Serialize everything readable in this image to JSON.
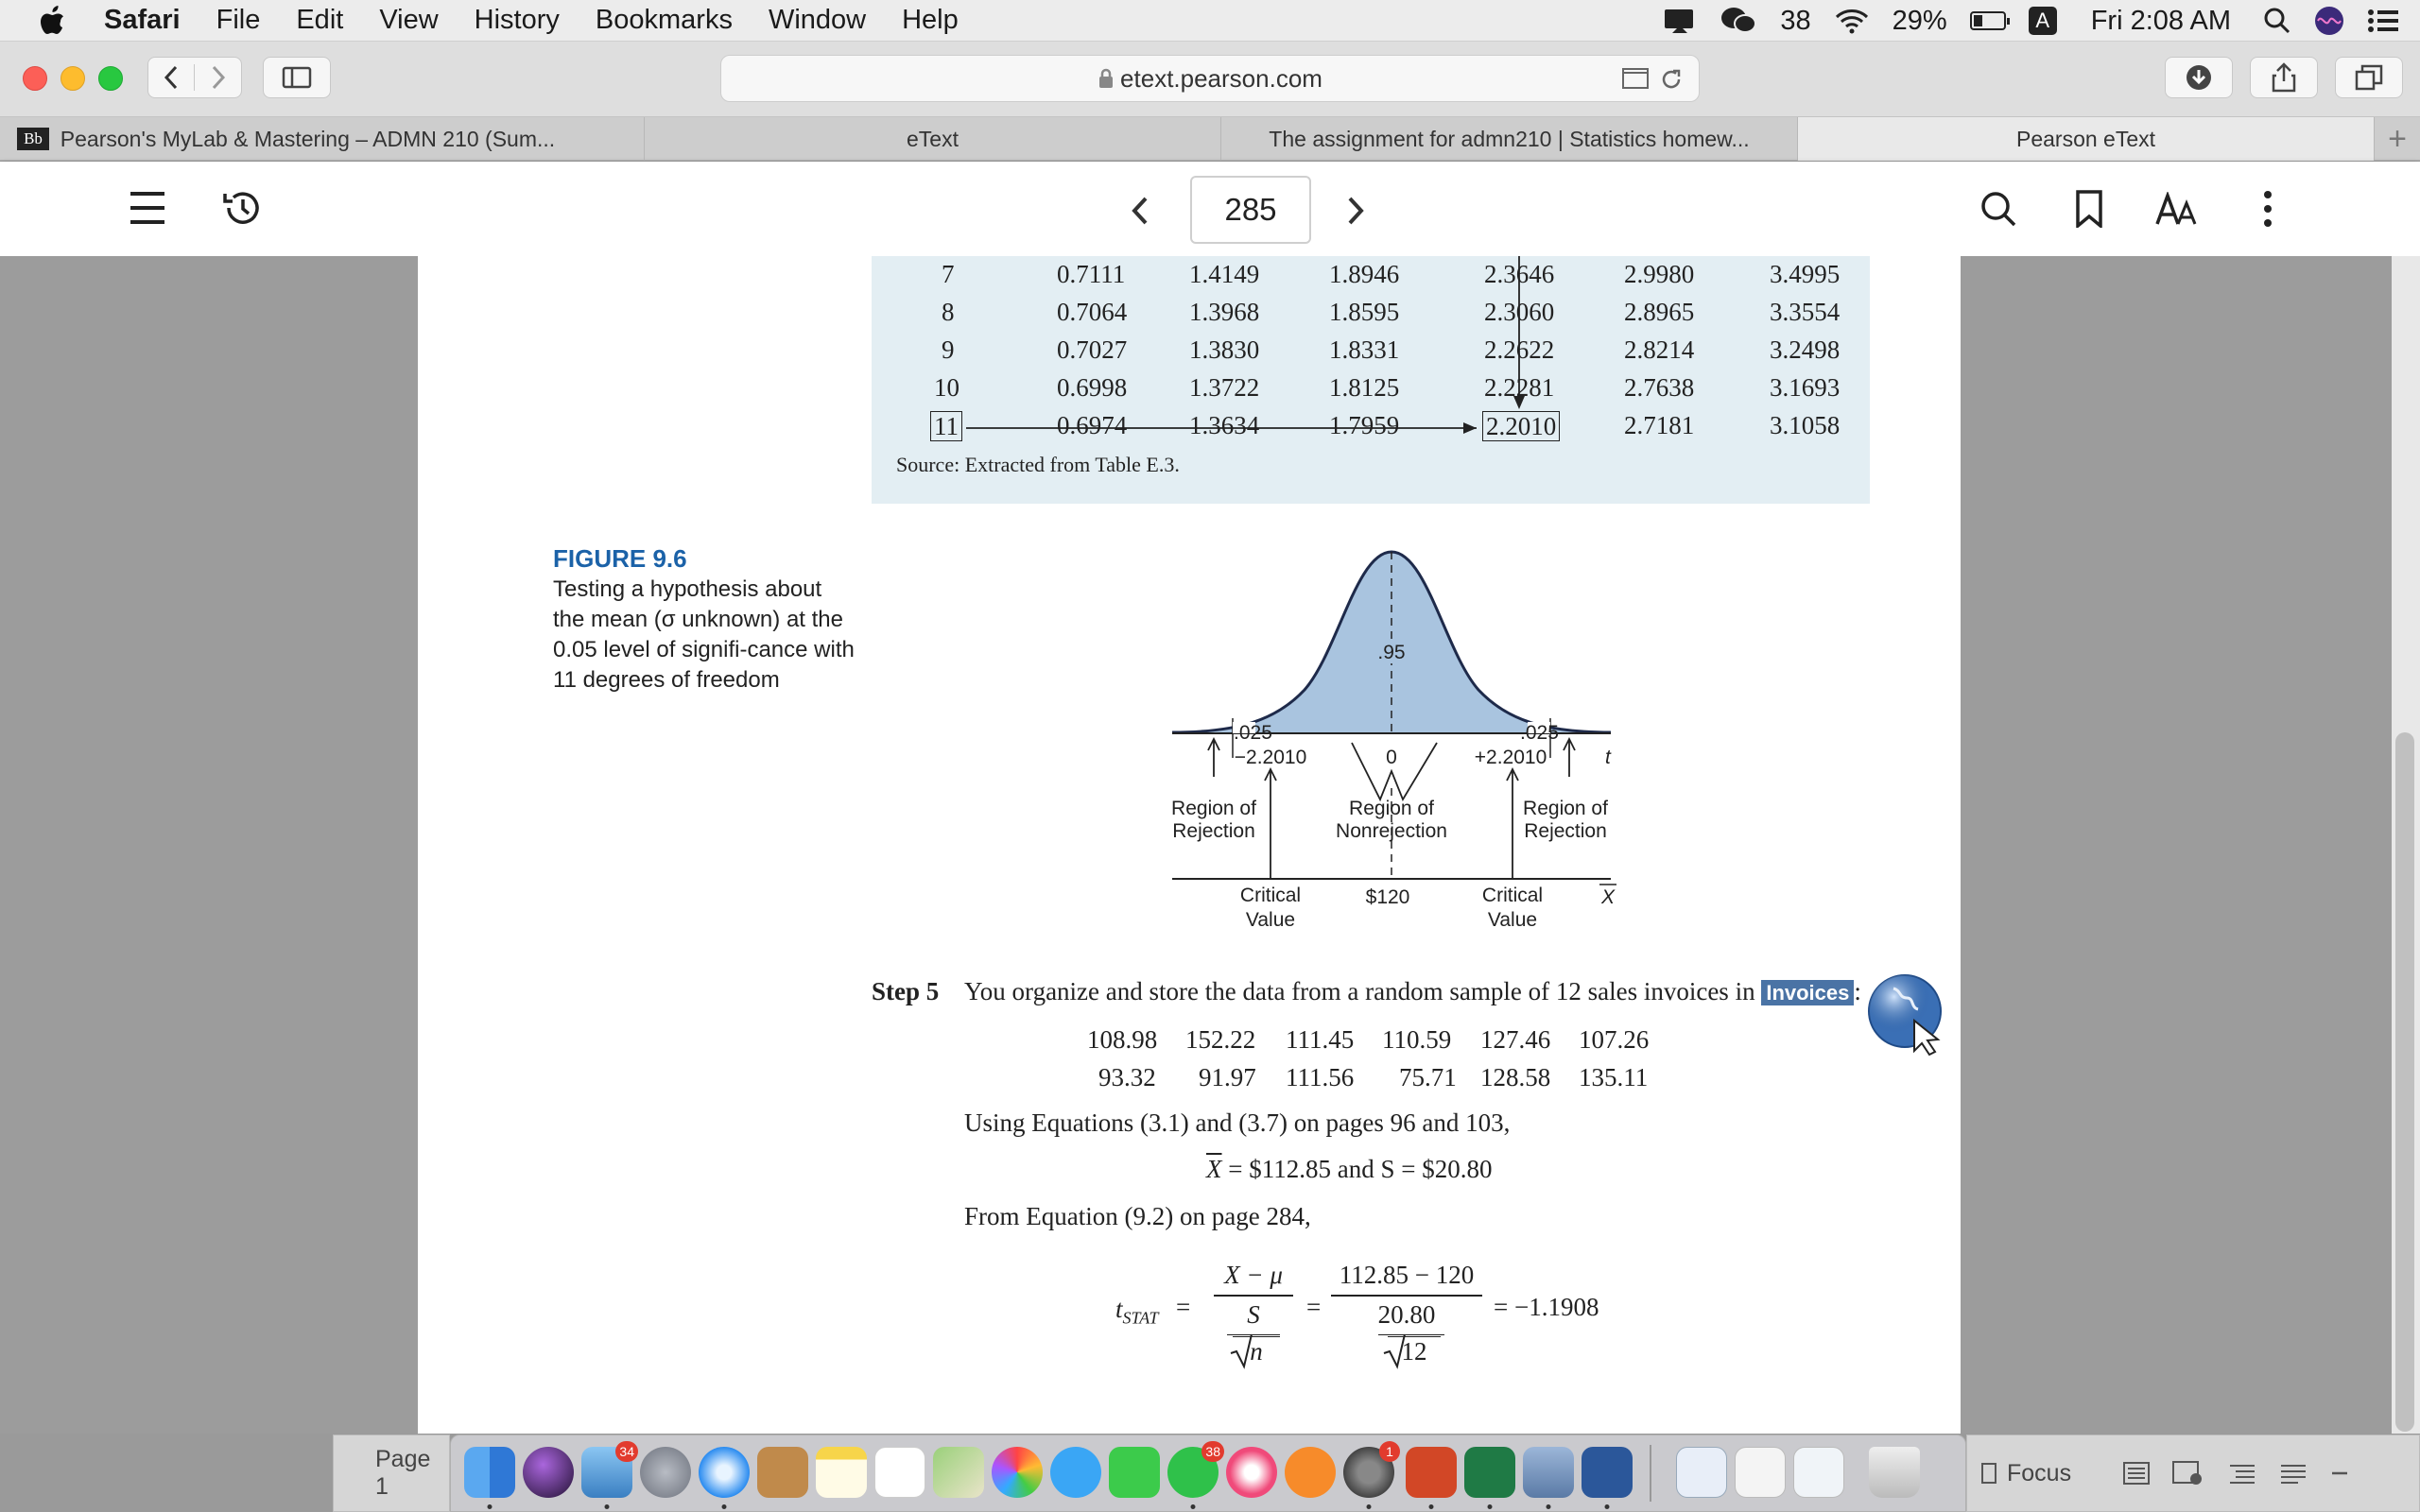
{
  "menubar": {
    "app": "Safari",
    "items": [
      "File",
      "Edit",
      "View",
      "History",
      "Bookmarks",
      "Window",
      "Help"
    ],
    "wechat_count": "38",
    "battery": "29%",
    "battery_level": 0.29,
    "input_source": "A",
    "clock": "Fri 2:08 AM"
  },
  "browser": {
    "url": "etext.pearson.com",
    "tabs": [
      {
        "label": "Pearson's MyLab & Mastering – ADMN 210 (Sum...",
        "badge": "Bb"
      },
      {
        "label": "eText"
      },
      {
        "label": "The assignment for admn210 | Statistics homew..."
      },
      {
        "label": "Pearson eText"
      }
    ],
    "new_tab": "+"
  },
  "reader": {
    "page_number": "285"
  },
  "table": {
    "rows": [
      [
        "7",
        "0.7111",
        "1.4149",
        "1.8946",
        "2.3646",
        "2.9980",
        "3.4995"
      ],
      [
        "8",
        "0.7064",
        "1.3968",
        "1.8595",
        "2.3060",
        "2.8965",
        "3.3554"
      ],
      [
        "9",
        "0.7027",
        "1.3830",
        "1.8331",
        "2.2622",
        "2.8214",
        "3.2498"
      ],
      [
        "10",
        "0.6998",
        "1.3722",
        "1.8125",
        "2.2281",
        "2.7638",
        "3.1693"
      ],
      [
        "11",
        "0.6974",
        "1.3634",
        "1.7959",
        "2.2010",
        "2.7181",
        "3.1058"
      ]
    ],
    "source": "Source: Extracted from Table E.3."
  },
  "figure": {
    "title": "FIGURE 9.6",
    "caption": "Testing a hypothesis about the mean (σ unknown) at the 0.05 level of signifi-cance with 11 degrees of freedom",
    "center_area": ".95",
    "tail_left": ".025",
    "tail_right": ".025",
    "crit_left": "−2.2010",
    "center_t": "0",
    "crit_right": "+2.2010",
    "t_axis": "t",
    "region_rej_left": [
      "Region of",
      "Rejection"
    ],
    "region_nonrej": [
      "Region of",
      "Nonrejection"
    ],
    "region_rej_right": [
      "Region of",
      "Rejection"
    ],
    "crit_value_left": [
      "Critical",
      "Value"
    ],
    "mu_value": "$120",
    "crit_value_right": [
      "Critical",
      "Value"
    ],
    "xbar_axis": "X"
  },
  "step5": {
    "label": "Step 5",
    "text": "You organize and store the data from a random sample of 12 sales invoices in",
    "file_chip": "Invoices",
    "colon": ":",
    "data_row1": [
      "108.98",
      "152.22",
      "111.45",
      "110.59",
      "127.46",
      "107.26"
    ],
    "data_row2": [
      "93.32",
      "91.97",
      "111.56",
      "75.71",
      "128.58",
      "135.11"
    ],
    "using_eq": "Using Equations (3.1) and (3.7) on pages 96 and 103,",
    "stats_line": "= $112.85 and S = $20.80",
    "stats_xbar": "X",
    "from_eq": "From Equation (9.2) on page 284,",
    "tstat_label": "t",
    "tstat_sub": "STAT",
    "frac1_num": "X − μ",
    "frac1_den_top": "S",
    "frac1_den_bot": "n",
    "frac2_num": "112.85 − 120",
    "frac2_den_top": "20.80",
    "frac2_den_bot": "12",
    "result": "= −1.1908"
  },
  "footer": {
    "page_label": "Page 1",
    "focus_label": "Focus"
  },
  "dock": {
    "badges": {
      "mail": "34",
      "wechat": "38",
      "prefs": "1"
    }
  },
  "colors": {
    "accent": "#1b62a8",
    "curve_fill": "#a9c4df",
    "table_bg": "#e3eef3"
  }
}
